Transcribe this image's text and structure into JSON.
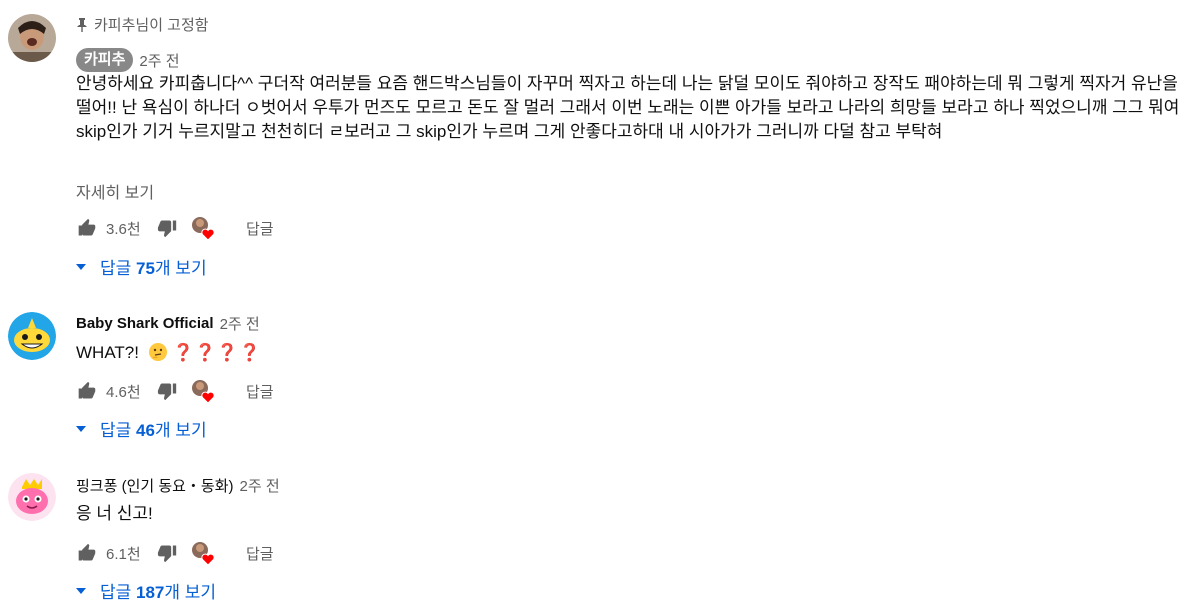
{
  "comments": [
    {
      "pinned_label": "카피추님이 고정함",
      "author": "카피추",
      "time": "2주 전",
      "text": "안녕하세요 카피춥니다^^ 구더작 여러분들 요즘 핸드박스님들이 자꾸머 찍자고 하는데 나는 닭덜 모이도 줘야하고 장작도 패야하는데 뭐 그렇게 찍자거 유난을 떨어!!  난 욕심이 하나더 ㅇ벗어서 우투가 먼즈도 모르고 돈도 잘 멀러 그래서 이번 노래는 이쁜 아가들 보라고 나라의 희망들 보라고 하나 찍었으니깨 그그 뭐여 skip인가 기거 누르지말고 천천히더 ㄹ보러고 그 skip인가 누르며 그게 안좋다고하대 내 시아가가 그러니까 다덜 참고 부탁혀",
      "more_label": "자세히 보기",
      "likes": "3.6천",
      "reply_label": "답글",
      "replies_prefix": "답글 ",
      "replies_count": "75",
      "replies_suffix": "개 보기"
    },
    {
      "author": "Baby Shark Official",
      "time": "2주 전",
      "text_prefix": "WHAT?!",
      "emoji_marks": "❓❓❓❓",
      "likes": "4.6천",
      "reply_label": "답글",
      "replies_prefix": "답글 ",
      "replies_count": "46",
      "replies_suffix": "개 보기"
    },
    {
      "author": "핑크퐁 (인기 동요・동화)",
      "time": "2주 전",
      "text": "응 너 신고!",
      "likes": "6.1천",
      "reply_label": "답글",
      "replies_prefix": "답글 ",
      "replies_count": "187",
      "replies_suffix": "개 보기"
    }
  ],
  "colors": {
    "link_blue": "#065fd4",
    "secondary_text": "#606060",
    "heart_red": "#ff0000",
    "chip_gray": "#888888"
  },
  "icons": [
    "pin-icon",
    "thumbs-up-icon",
    "thumbs-down-icon",
    "creator-heart-icon",
    "expand-triangle-icon",
    "thinking-face-emoji"
  ]
}
